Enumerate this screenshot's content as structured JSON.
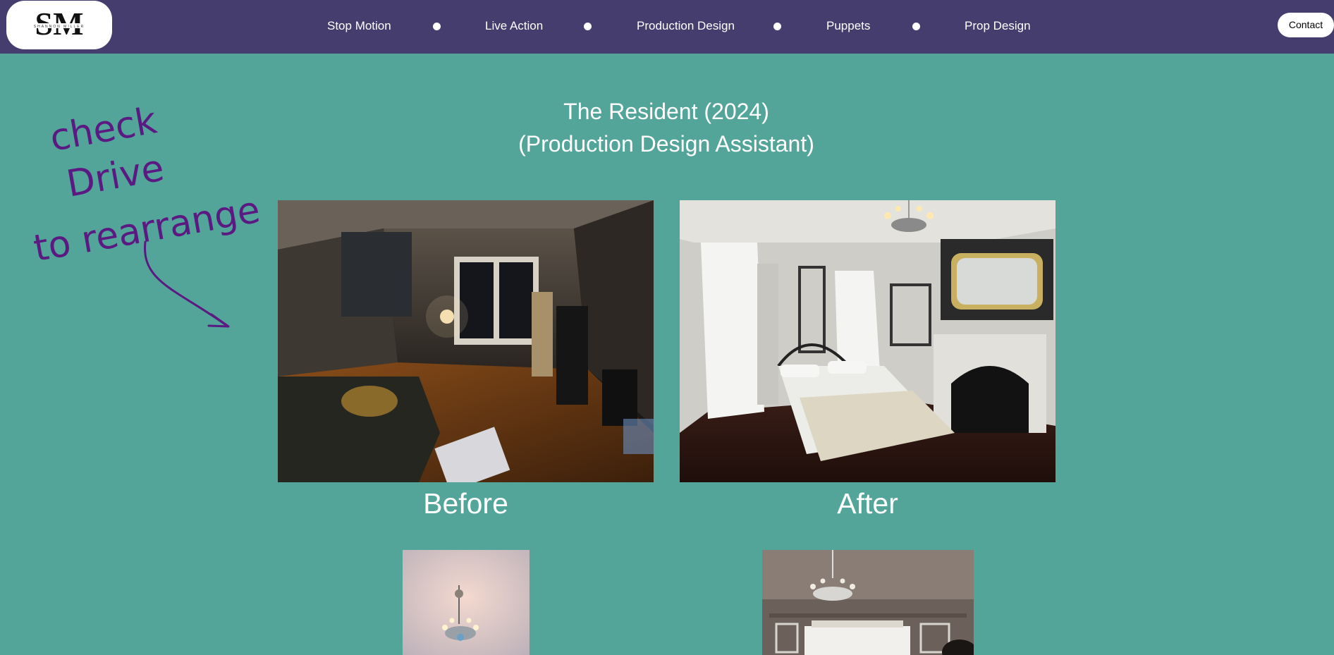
{
  "header": {
    "logo_icon": "monogram-sm-logo",
    "logo_text": "SM",
    "logo_subtext": "SHANNON MILLER",
    "nav": [
      {
        "label": "Stop Motion"
      },
      {
        "label": "Live Action"
      },
      {
        "label": "Production Design"
      },
      {
        "label": "Puppets"
      },
      {
        "label": "Prop Design"
      }
    ],
    "contact_label": "Contact"
  },
  "page": {
    "title_line1": "The Resident (2024)",
    "title_line2": "(Production Design Assistant)"
  },
  "annotation": {
    "lines": [
      "check",
      "Drive",
      "to rearrange"
    ],
    "icon": "hand-drawn-arrow-icon",
    "color": "#5b1a82"
  },
  "gallery": {
    "before_image": "before-living-room-photo",
    "after_image": "after-bedroom-photo",
    "before_caption": "Before",
    "after_caption": "After",
    "lower_left_image": "chandelier-ceiling-photo",
    "lower_right_image": "room-chandelier-photo"
  },
  "colors": {
    "background": "#53a599",
    "header": "#463d6f",
    "text": "#ffffff"
  }
}
